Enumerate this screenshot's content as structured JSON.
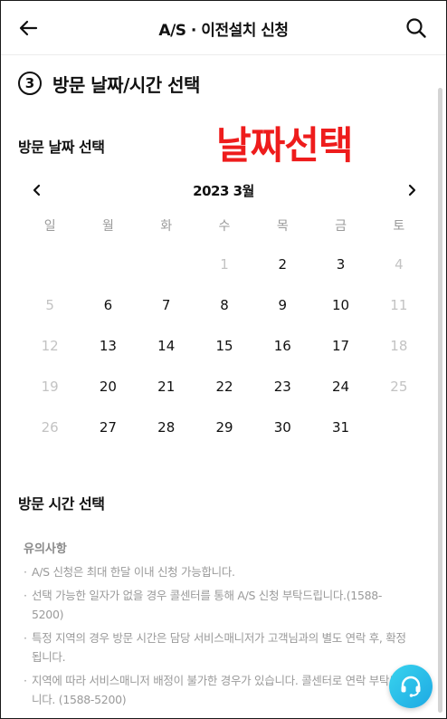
{
  "header": {
    "title": "A/S · 이전설치 신청",
    "back_icon": "arrow-left-icon",
    "search_icon": "search-icon"
  },
  "step": {
    "number": "3",
    "title": "방문 날짜/시간 선택"
  },
  "date_section": {
    "title": "방문 날짜 선택",
    "annotation": "날짜선택",
    "annotation_color": "#ee1c1c"
  },
  "calendar": {
    "month_label": "2023 3월",
    "weekdays": [
      "일",
      "월",
      "화",
      "수",
      "목",
      "금",
      "토"
    ],
    "weeks": [
      [
        {
          "d": "",
          "s": "empty"
        },
        {
          "d": "",
          "s": "empty"
        },
        {
          "d": "",
          "s": "empty"
        },
        {
          "d": "1",
          "s": "muted"
        },
        {
          "d": "2",
          "s": "active"
        },
        {
          "d": "3",
          "s": "active"
        },
        {
          "d": "4",
          "s": "muted"
        }
      ],
      [
        {
          "d": "5",
          "s": "muted"
        },
        {
          "d": "6",
          "s": "active"
        },
        {
          "d": "7",
          "s": "active"
        },
        {
          "d": "8",
          "s": "active"
        },
        {
          "d": "9",
          "s": "active"
        },
        {
          "d": "10",
          "s": "active"
        },
        {
          "d": "11",
          "s": "muted"
        }
      ],
      [
        {
          "d": "12",
          "s": "muted"
        },
        {
          "d": "13",
          "s": "active"
        },
        {
          "d": "14",
          "s": "active"
        },
        {
          "d": "15",
          "s": "active"
        },
        {
          "d": "16",
          "s": "active"
        },
        {
          "d": "17",
          "s": "active"
        },
        {
          "d": "18",
          "s": "muted"
        }
      ],
      [
        {
          "d": "19",
          "s": "muted"
        },
        {
          "d": "20",
          "s": "active"
        },
        {
          "d": "21",
          "s": "active"
        },
        {
          "d": "22",
          "s": "active"
        },
        {
          "d": "23",
          "s": "active"
        },
        {
          "d": "24",
          "s": "active"
        },
        {
          "d": "25",
          "s": "muted"
        }
      ],
      [
        {
          "d": "26",
          "s": "muted"
        },
        {
          "d": "27",
          "s": "active"
        },
        {
          "d": "28",
          "s": "active"
        },
        {
          "d": "29",
          "s": "active"
        },
        {
          "d": "30",
          "s": "active"
        },
        {
          "d": "31",
          "s": "active"
        },
        {
          "d": "",
          "s": "empty"
        }
      ]
    ]
  },
  "time_section": {
    "title": "방문 시간 선택"
  },
  "notice": {
    "title": "유의사항",
    "items": [
      "A/S 신청은 최대 한달 이내 신청 가능합니다.",
      "선택 가능한 일자가 없을 경우 콜센터를 통해 A/S 신청 부탁드립니다.(1588-5200)",
      "특정 지역의 경우 방문 시간은 담당 서비스매니저가 고객님과의 별도 연락 후, 확정됩니다.",
      "지역에 따라 서비스매니저 배정이 불가한 경우가 있습니다. 콜센터로 연락 부탁드립니다. (1588-5200)"
    ]
  },
  "floating": {
    "support_icon": "headset-icon",
    "accent_color": "#1ea9e3"
  }
}
